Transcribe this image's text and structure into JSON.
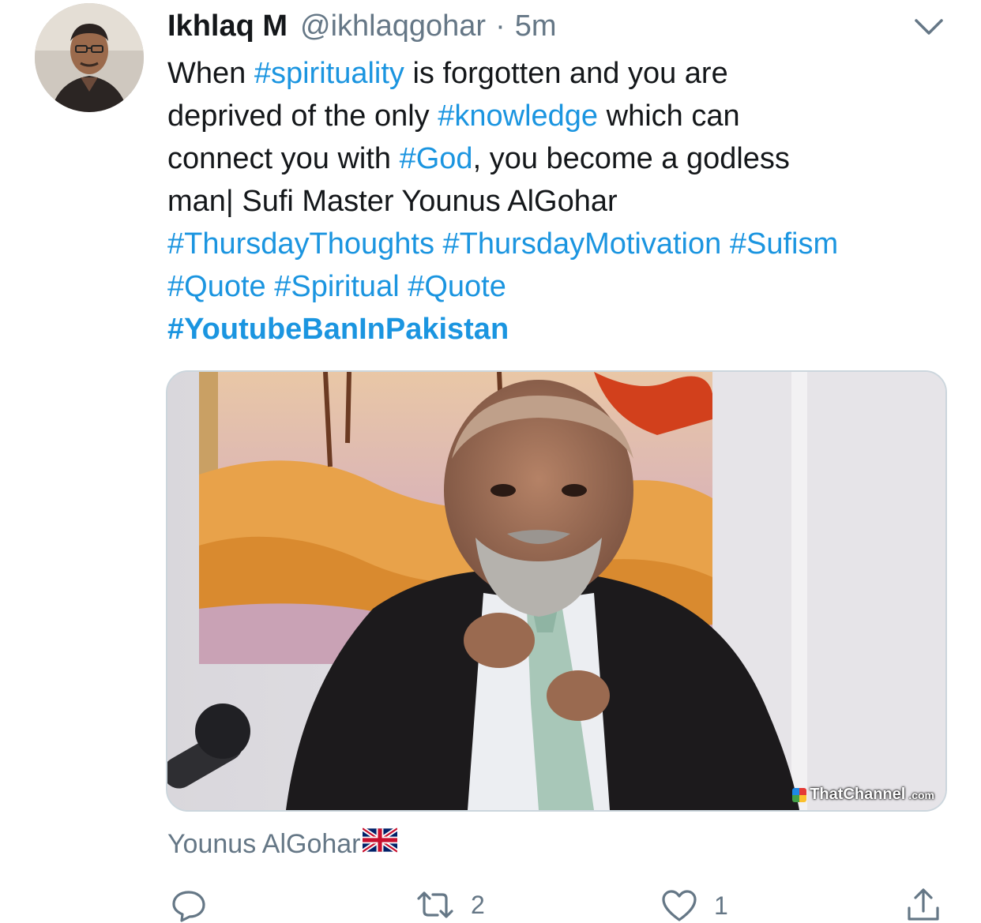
{
  "tweet": {
    "display_name": "Ikhlaq M",
    "handle": "@ikhlaqgohar",
    "separator": "·",
    "time": "5m",
    "text_lines": [
      [
        {
          "t": "When ",
          "tag": false
        },
        {
          "t": "#spirituality",
          "tag": true
        },
        {
          "t": " is forgotten and you are",
          "tag": false
        }
      ],
      [
        {
          "t": "deprived of the only ",
          "tag": false
        },
        {
          "t": "#knowledge",
          "tag": true
        },
        {
          "t": " which can",
          "tag": false
        }
      ],
      [
        {
          "t": "connect you with ",
          "tag": false
        },
        {
          "t": "#God",
          "tag": true
        },
        {
          "t": ", you become a godless",
          "tag": false
        }
      ],
      [
        {
          "t": "man| Sufi Master Younus AlGohar",
          "tag": false
        }
      ],
      [
        {
          "t": "#ThursdayThoughts",
          "tag": true
        },
        {
          "t": " ",
          "tag": false
        },
        {
          "t": "#ThursdayMotivation",
          "tag": true
        },
        {
          "t": " ",
          "tag": false
        },
        {
          "t": "#Sufism",
          "tag": true
        }
      ],
      [
        {
          "t": "#Quote",
          "tag": true
        },
        {
          "t": " ",
          "tag": false
        },
        {
          "t": "#Spiritual",
          "tag": true
        },
        {
          "t": " ",
          "tag": false
        },
        {
          "t": "#Quote",
          "tag": true
        }
      ],
      [
        {
          "t": "#YoutubeBanInPakistan",
          "tag": true,
          "bold": true
        }
      ]
    ],
    "media": {
      "watermark_brand": "ThatChannel",
      "watermark_suffix": ".com"
    },
    "media_caption": "Younus AlGohar",
    "caption_flag_icon": "uk-flag-icon",
    "actions": {
      "reply_icon": "reply-icon",
      "retweet_icon": "retweet-icon",
      "retweet_count": "2",
      "like_icon": "heart-icon",
      "like_count": "1",
      "share_icon": "share-icon"
    },
    "menu_icon": "chevron-down-icon",
    "colors": {
      "link": "#1b95e0",
      "secondary": "#657786",
      "text": "#14171a",
      "border": "#ccd6dd"
    }
  }
}
